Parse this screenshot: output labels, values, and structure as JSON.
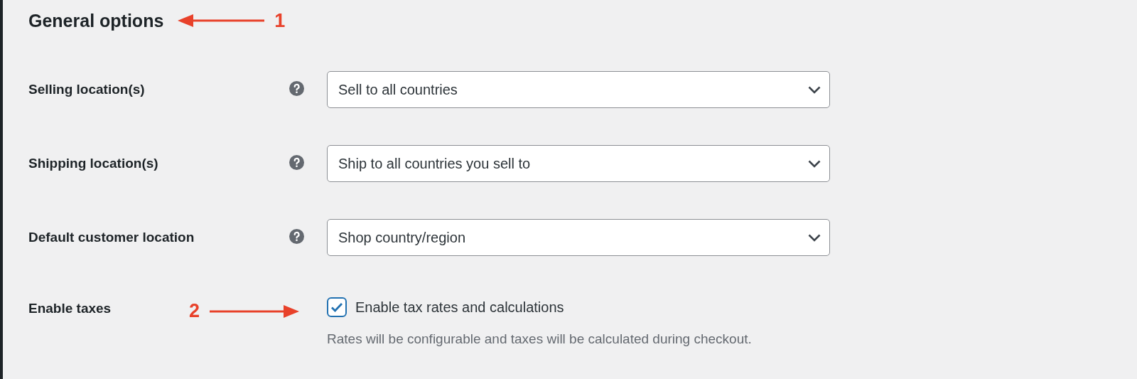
{
  "heading": {
    "title": "General options",
    "annotation": "1"
  },
  "fields": [
    {
      "kind": "select",
      "label": "Selling location(s)",
      "help": true,
      "value": "Sell to all countries"
    },
    {
      "kind": "select",
      "label": "Shipping location(s)",
      "help": true,
      "value": "Ship to all countries you sell to"
    },
    {
      "kind": "select",
      "label": "Default customer location",
      "help": true,
      "value": "Shop country/region"
    },
    {
      "kind": "checkbox",
      "label": "Enable taxes",
      "annotation": "2",
      "checked": true,
      "option": "Enable tax rates and calculations",
      "description": "Rates will be configurable and taxes will be calculated during checkout."
    }
  ]
}
